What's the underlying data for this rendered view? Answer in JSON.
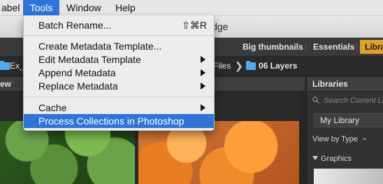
{
  "menubar": {
    "items": [
      {
        "label": "abel"
      },
      {
        "label": "Tools"
      },
      {
        "label": "Window"
      },
      {
        "label": "Help"
      }
    ]
  },
  "window": {
    "title_fragment": "idge"
  },
  "toolbar": {
    "tabs": [
      "Big thumbnails",
      "Essentials",
      "Libra"
    ]
  },
  "pathbar": {
    "left": "Ex_P",
    "mid": "Files",
    "current": "06 Layers"
  },
  "panels": {
    "left_tab": "ew",
    "libraries_title": "Libraries"
  },
  "libraries": {
    "search_placeholder": "Search Current Li",
    "selected_library": "My Library",
    "view_by": "View by Type",
    "section": "Graphics"
  },
  "menu": {
    "items": [
      {
        "label": "Batch Rename...",
        "shortcut": "⇧⌘R",
        "submenu": false
      },
      {
        "label": "Create Metadata Template...",
        "shortcut": "",
        "submenu": false
      },
      {
        "label": "Edit Metadata Template",
        "shortcut": "",
        "submenu": true
      },
      {
        "label": "Append Metadata",
        "shortcut": "",
        "submenu": true
      },
      {
        "label": "Replace Metadata",
        "shortcut": "",
        "submenu": true
      },
      {
        "label": "Cache",
        "shortcut": "",
        "submenu": true
      },
      {
        "label": "Process Collections in Photoshop",
        "shortcut": "",
        "submenu": false
      }
    ]
  },
  "colors": {
    "menu_highlight": "#2f74d6",
    "accent": "#e1a12b",
    "folder": "#52a9ec"
  }
}
